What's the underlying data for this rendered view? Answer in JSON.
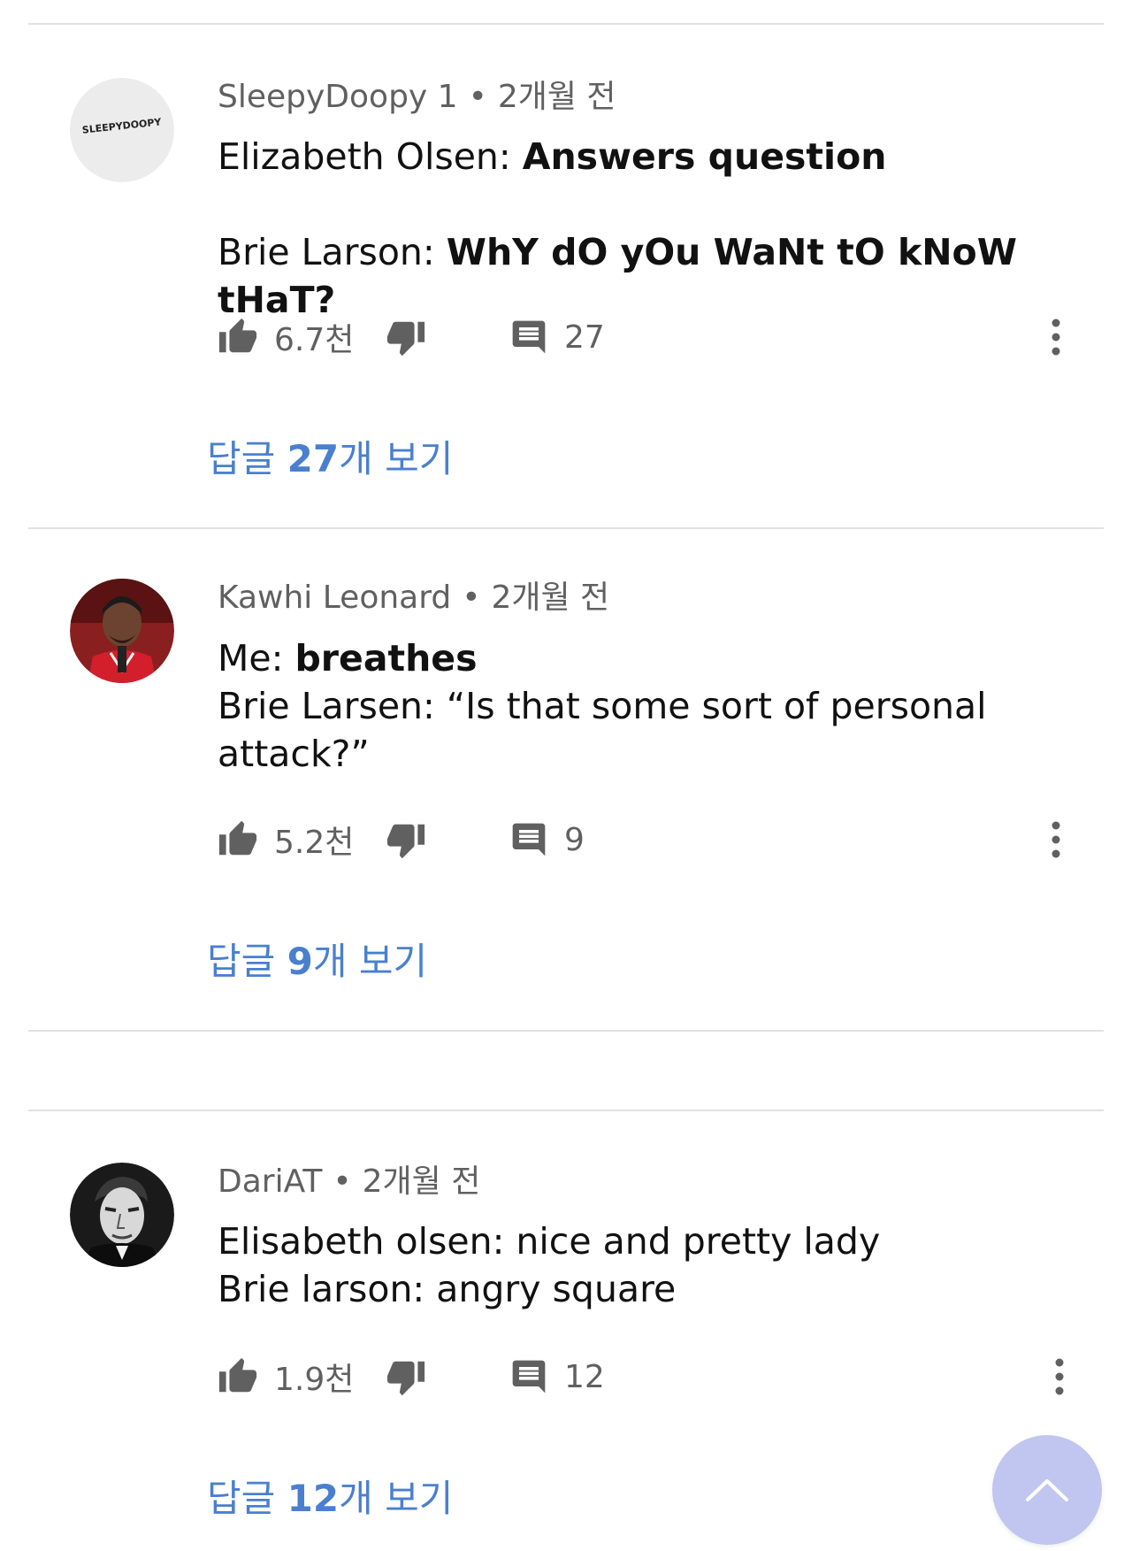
{
  "comments": [
    {
      "author": "SleepyDoopy 1",
      "time": "2개월 전",
      "avatar_text": "SLEEPYDOOPY",
      "lines": [
        {
          "prefix": "Elizabeth Olsen: ",
          "bold": "Answers question"
        },
        {
          "prefix": "",
          "bold": ""
        },
        {
          "prefix": "Brie Larson: ",
          "bold": "WhY dO yOu WaNt tO kNoW tHaT?"
        }
      ],
      "likes": "6.7천",
      "reply_count": "27",
      "replies_pre": "답글 ",
      "replies_num": "27",
      "replies_post": "개 보기"
    },
    {
      "author": "Kawhi Leonard",
      "time": "2개월 전",
      "lines": [
        {
          "prefix": "Me: ",
          "bold": "breathes"
        },
        {
          "prefix": "Brie Larsen: “Is that some sort of personal",
          "bold": ""
        },
        {
          "prefix": "attack?”",
          "bold": ""
        }
      ],
      "likes": "5.2천",
      "reply_count": "9",
      "replies_pre": "답글 ",
      "replies_num": "9",
      "replies_post": "개 보기"
    },
    {
      "author": "DariAT",
      "time": "2개월 전",
      "lines": [
        {
          "prefix": "Elisabeth olsen: nice and pretty lady",
          "bold": ""
        },
        {
          "prefix": "Brie larson: angry square",
          "bold": ""
        }
      ],
      "likes": "1.9천",
      "reply_count": "12",
      "replies_pre": "답글 ",
      "replies_num": "12",
      "replies_post": "개 보기"
    }
  ],
  "colors": {
    "meta": "#606060",
    "link": "#4a7fd0",
    "icon": "#606060",
    "fab": "#c0c6ef",
    "divider": "#e1e1e1"
  },
  "icons": {
    "like": "thumb-up-icon",
    "dislike": "thumb-down-icon",
    "reply": "comment-icon",
    "more": "more-vertical-icon",
    "scroll_top": "chevron-up-icon"
  }
}
